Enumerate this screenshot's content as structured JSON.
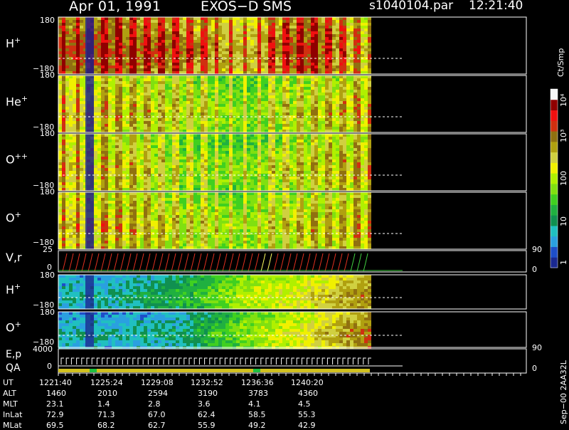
{
  "header": {
    "date": "Apr 01, 1991",
    "instrument": "EXOS−D SMS",
    "file": "s1040104.par",
    "time": "12:21:40"
  },
  "panels": [
    {
      "name": "H",
      "charge": "+",
      "ytop": "180",
      "ybot": "−180"
    },
    {
      "name": "He",
      "charge": "+",
      "ytop": "180",
      "ybot": "−180"
    },
    {
      "name": "O",
      "charge": "++",
      "ytop": "180",
      "ybot": "−180"
    },
    {
      "name": "O",
      "charge": "+",
      "ytop": "180",
      "ybot": "−180"
    }
  ],
  "vr_panel": {
    "label": "V,r",
    "ytop": "25",
    "ybot": "0",
    "right_top": "90",
    "right_bot": "0"
  },
  "lower_panels": [
    {
      "name": "H",
      "charge": "+",
      "ytop": "180",
      "ybot": "−180"
    },
    {
      "name": "O",
      "charge": "+",
      "ytop": "180",
      "ybot": "−180"
    }
  ],
  "ep_panel": {
    "label1": "E,p",
    "label2": "QA",
    "ytop": "4000",
    "ybot": "0",
    "right_top": "90",
    "right_bot": "0"
  },
  "colorbar": {
    "unit": "Ct/Smp",
    "labels": [
      {
        "text": "1",
        "value": 1
      },
      {
        "text": "10",
        "value": 10
      },
      {
        "text": "100",
        "value": 100
      },
      {
        "text": "10³",
        "value": 1000
      },
      {
        "text": "10⁴",
        "value": 10000
      }
    ],
    "colors": [
      "#1a2890",
      "#1e4ec8",
      "#2aa0e0",
      "#20c0c0",
      "#109050",
      "#20b040",
      "#40d020",
      "#80e010",
      "#b0f000",
      "#f0f000",
      "#d0d040",
      "#b0a010",
      "#907010",
      "#d03010",
      "#f01010",
      "#900000",
      "#f8f8f8"
    ]
  },
  "footer_code": "Sep−00 2AA32L",
  "ephemeris": {
    "rows": [
      {
        "label": "UT",
        "values": [
          "1221:40",
          "1225:24",
          "1229:08",
          "1232:52",
          "1236:36",
          "1240:20"
        ]
      },
      {
        "label": "ALT",
        "values": [
          "1460",
          "2010",
          "2594",
          "3190",
          "3783",
          "4360"
        ]
      },
      {
        "label": "MLT",
        "values": [
          "23.1",
          "1.4",
          "2.8",
          "3.6",
          "4.1",
          "4.5"
        ]
      },
      {
        "label": "InLat",
        "values": [
          "72.9",
          "71.3",
          "67.0",
          "62.4",
          "58.5",
          "55.3"
        ]
      },
      {
        "label": "MLat",
        "values": [
          "69.5",
          "68.2",
          "62.7",
          "55.9",
          "49.2",
          "42.9"
        ]
      }
    ]
  },
  "chart_data": {
    "type": "heatmap",
    "title": "Apr 01, 1991 EXOS−D SMS",
    "x_label": "UT",
    "x_ticks": [
      "1221:40",
      "1225:24",
      "1229:08",
      "1232:52",
      "1236:36",
      "1240:20"
    ],
    "y_range": [
      -180,
      180
    ],
    "color_scale": "log",
    "color_range": [
      1,
      10000
    ],
    "color_unit": "Ct/Smp",
    "series": [
      {
        "name": "H+",
        "mean_log_counts_by_tick": [
          3.3,
          3.2,
          3.0,
          2.7,
          3.3,
          2.4
        ]
      },
      {
        "name": "He+",
        "mean_log_counts_by_tick": [
          2.6,
          2.3,
          2.0,
          1.8,
          2.1,
          2.4
        ]
      },
      {
        "name": "O++",
        "mean_log_counts_by_tick": [
          2.6,
          2.3,
          1.8,
          1.8,
          2.1,
          2.4
        ]
      },
      {
        "name": "O+",
        "mean_log_counts_by_tick": [
          2.6,
          2.4,
          2.0,
          1.9,
          2.2,
          2.4
        ]
      },
      {
        "name": "H+ (lower)",
        "mean_log_counts_by_tick": [
          0.5,
          0.6,
          1.0,
          1.8,
          2.2,
          2.8
        ]
      },
      {
        "name": "O+ (lower)",
        "mean_log_counts_by_tick": [
          0.5,
          0.5,
          0.7,
          1.6,
          2.2,
          3.0
        ]
      }
    ]
  }
}
